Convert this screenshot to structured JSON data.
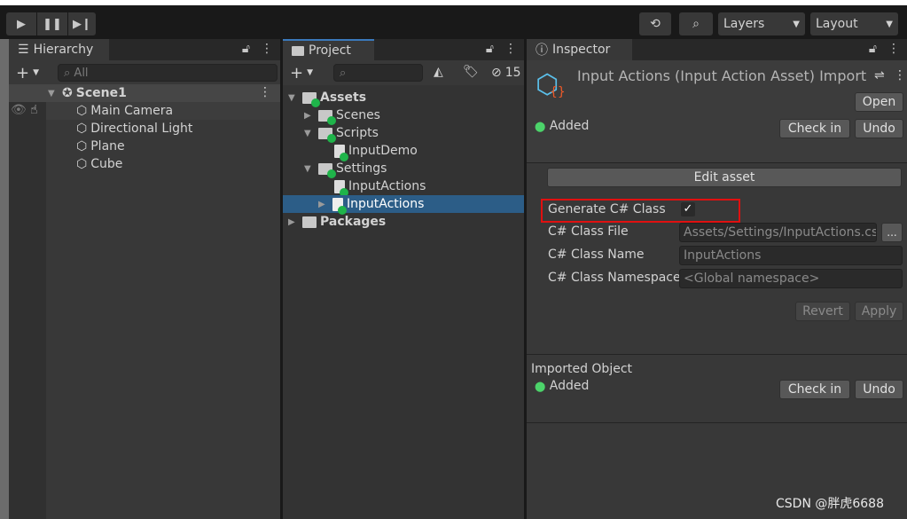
{
  "toolbar": {
    "play_icon": "play-icon",
    "pause_icon": "pause-icon",
    "step_icon": "step-icon",
    "history_icon": "history-icon",
    "search_icon": "search-icon",
    "layers": "Layers",
    "layout": "Layout"
  },
  "hierarchy": {
    "tab": "Hierarchy",
    "search_placeholder": "All",
    "scene": "Scene1",
    "items": [
      "Main Camera",
      "Directional Light",
      "Plane",
      "Cube"
    ]
  },
  "project": {
    "tab": "Project",
    "hidden_count": "15",
    "tree": [
      "Assets",
      "Scenes",
      "Scripts",
      "InputDemo",
      "Settings",
      "InputActions",
      "InputActions",
      "Packages"
    ]
  },
  "inspector": {
    "tab": "Inspector",
    "title": "Input Actions (Input Action Asset) Import",
    "open": "Open",
    "status": "Added",
    "check_in": "Check in",
    "undo": "Undo",
    "edit_asset": "Edit asset",
    "generate_label": "Generate C# Class",
    "generate_checked": true,
    "class_file_label": "C# Class File",
    "class_file": "Assets/Settings/InputActions.cs",
    "browse": "...",
    "class_name_label": "C# Class Name",
    "class_name": "InputActions",
    "namespace_label": "C# Class Namespace",
    "namespace_placeholder": "<Global namespace>",
    "revert": "Revert",
    "apply": "Apply",
    "imported_object": "Imported Object",
    "imported_status": "Added",
    "check_in2": "Check in",
    "undo2": "Undo",
    "highlight_color": "#e01010"
  },
  "watermark": "CSDN @胖虎6688"
}
